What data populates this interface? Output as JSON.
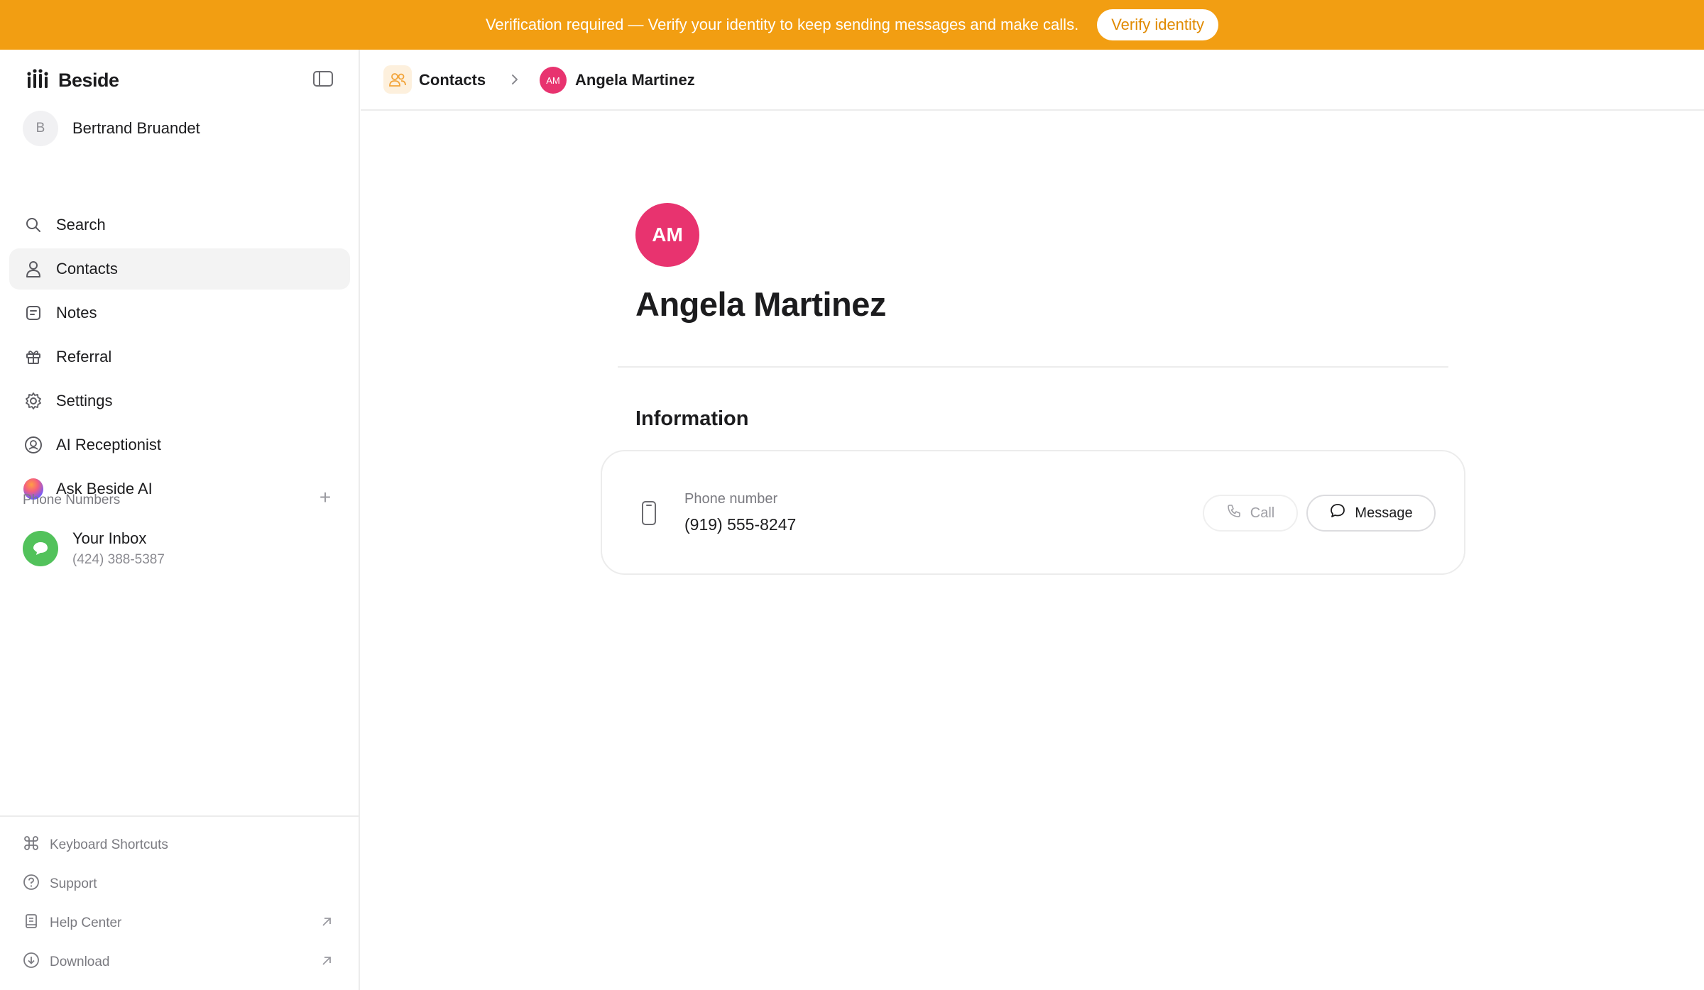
{
  "banner": {
    "text": "Verification required — Verify your identity to keep sending messages and make calls.",
    "button_label": "Verify identity",
    "color": "#f29e12"
  },
  "sidebar": {
    "brand": "Beside",
    "user": {
      "initial": "B",
      "name": "Bertrand Bruandet"
    },
    "nav": [
      {
        "label": "Search",
        "icon": "search-icon"
      },
      {
        "label": "Contacts",
        "icon": "person-icon",
        "active": true
      },
      {
        "label": "Notes",
        "icon": "note-icon"
      },
      {
        "label": "Referral",
        "icon": "gift-icon"
      },
      {
        "label": "Settings",
        "icon": "gear-icon"
      },
      {
        "label": "AI Receptionist",
        "icon": "ai-receptionist-icon"
      },
      {
        "label": "Ask Beside AI",
        "icon": "ai-orb-icon"
      }
    ],
    "phone_numbers": {
      "label": "Phone Numbers",
      "inbox": {
        "name": "Your Inbox",
        "phone": "(424) 388-5387",
        "color": "#52c25b"
      }
    },
    "footer": [
      {
        "label": "Keyboard Shortcuts",
        "icon": "command-icon"
      },
      {
        "label": "Support",
        "icon": "question-icon"
      },
      {
        "label": "Help Center",
        "icon": "book-icon",
        "external": true
      },
      {
        "label": "Download",
        "icon": "download-icon",
        "external": true
      }
    ]
  },
  "breadcrumb": {
    "section": "Contacts",
    "contact_initials": "AM",
    "contact_name": "Angela Martinez"
  },
  "contact": {
    "initials": "AM",
    "name": "Angela Martinez",
    "avatar_color": "#e8336f",
    "section_title": "Information",
    "phone_label": "Phone number",
    "phone_value": "(919) 555-8247",
    "call_label": "Call",
    "message_label": "Message"
  }
}
